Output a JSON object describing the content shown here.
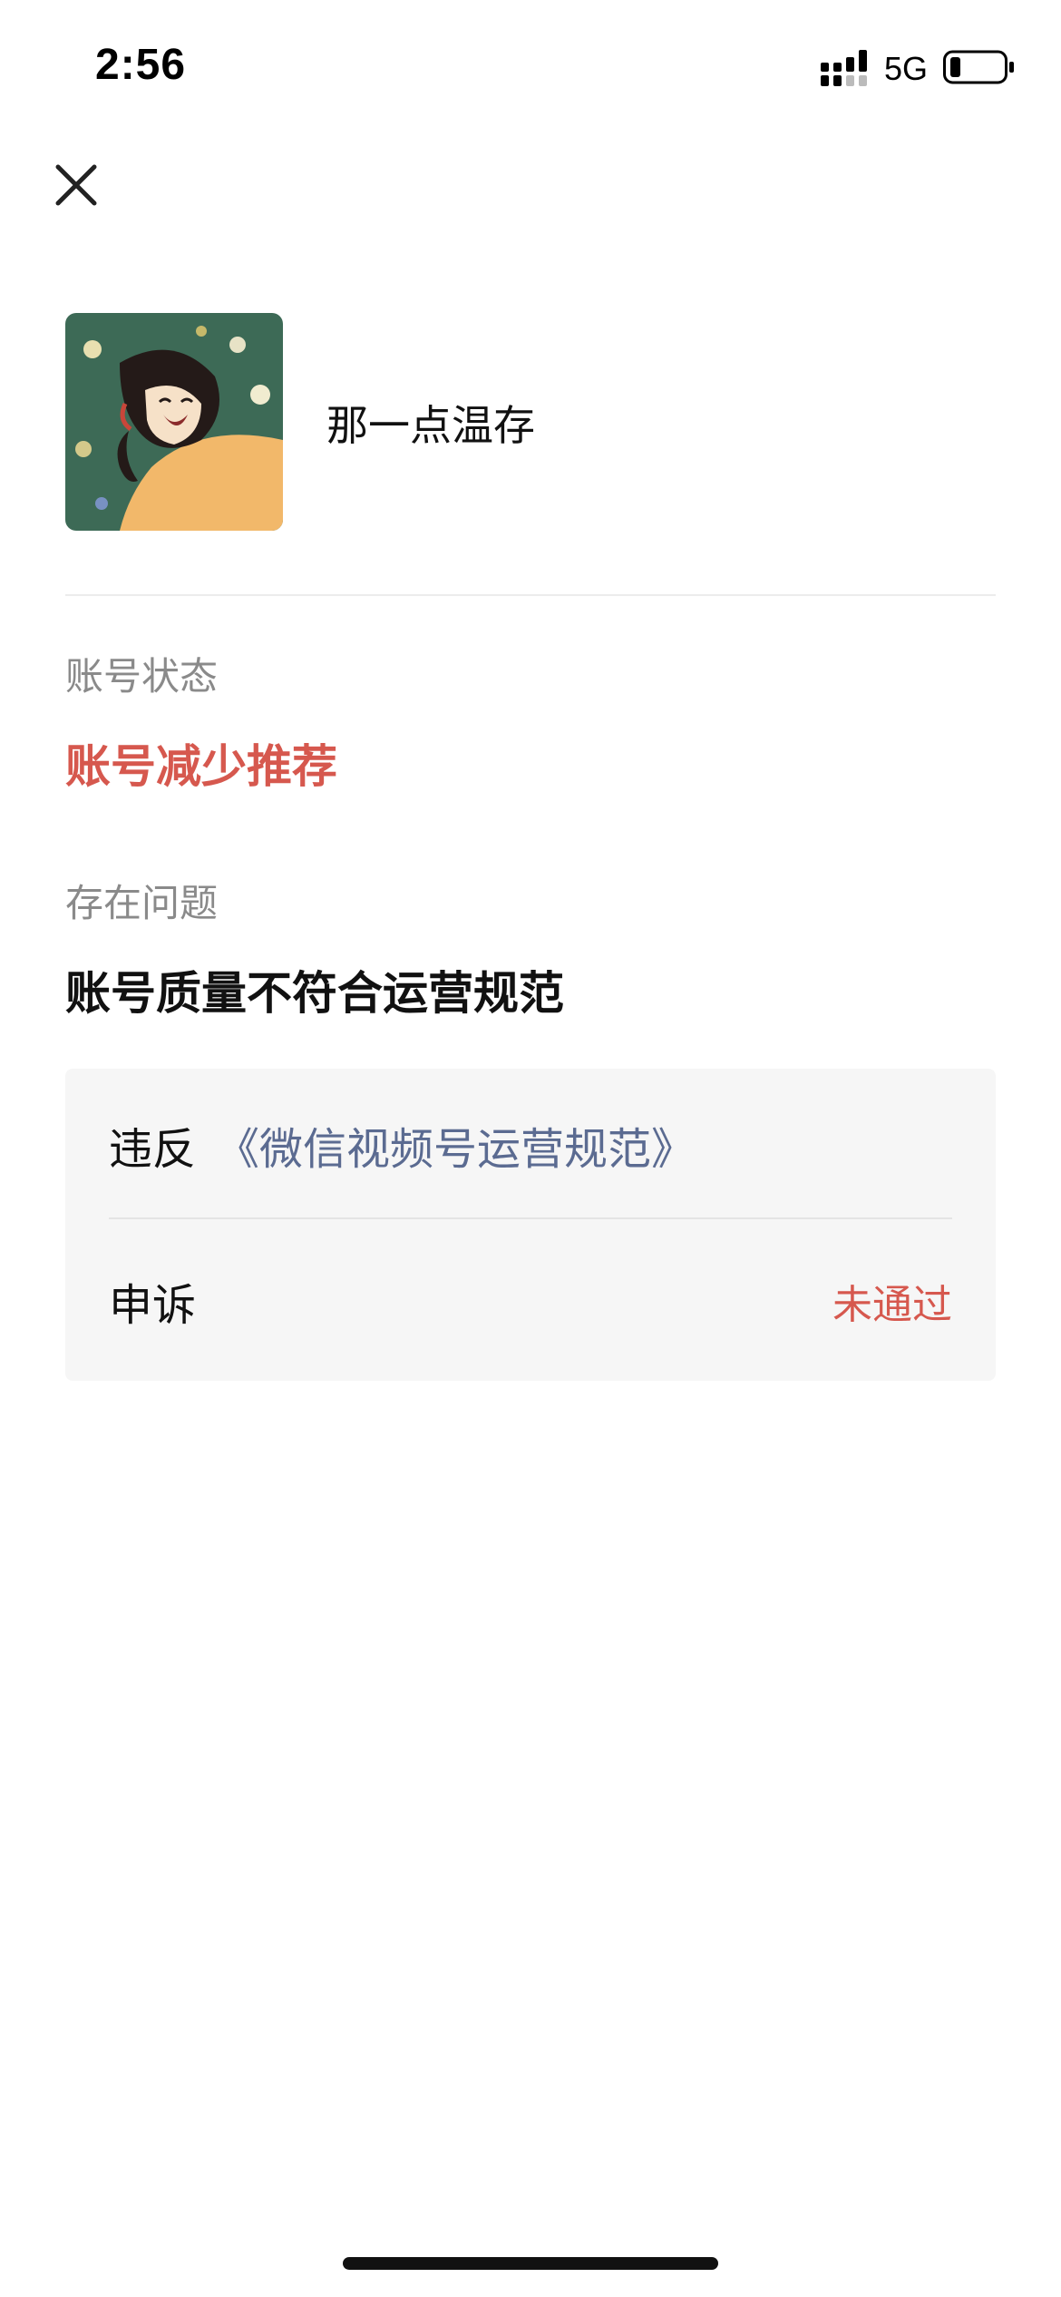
{
  "status_bar": {
    "time": "2:56",
    "network": "5G",
    "signal_icon": "signal-bars-icon",
    "battery_icon": "battery-low-icon"
  },
  "header": {
    "close_icon": "close-icon"
  },
  "profile": {
    "name": "那一点温存",
    "avatar": "avatar-image"
  },
  "account_status": {
    "label": "账号状态",
    "value": "账号减少推荐",
    "value_color": "#d6584e"
  },
  "problem": {
    "label": "存在问题",
    "value": "账号质量不符合运营规范"
  },
  "details": {
    "violation_prefix": "违反",
    "violation_link": "《微信视频号运营规范》",
    "link_color": "#5b6b91",
    "appeal_label": "申诉",
    "appeal_status": "未通过",
    "appeal_status_color": "#d6584e"
  }
}
